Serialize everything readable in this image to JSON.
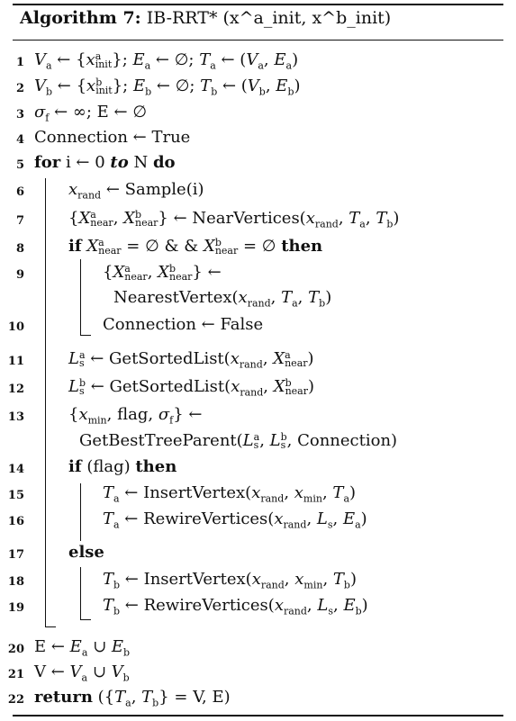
{
  "algorithm": {
    "title_label": "Algorithm 7:",
    "title_text": "IB-RRT* (x^a_init, x^b_init)",
    "lines": [
      {
        "num": "1",
        "text": "V_a ← {x^a_init}; E_a ← ∅; T_a ← (V_a, E_a)"
      },
      {
        "num": "2",
        "text": "V_b ← {x^b_init}; E_b ← ∅; T_b ← (V_b, E_b)"
      },
      {
        "num": "3",
        "text": "σ_f ← ∞; E ← ∅"
      },
      {
        "num": "4",
        "text": "Connection ← True"
      },
      {
        "num": "5",
        "text": "for i ← 0 to N do"
      },
      {
        "num": "6",
        "text": "x_rand ← Sample(i)"
      },
      {
        "num": "7",
        "text": "{X^a_near, X^b_near} ← NearVertices(x_rand, T_a, T_b)"
      },
      {
        "num": "8",
        "text": "if X^a_near = ∅ & & X^b_near = ∅ then"
      },
      {
        "num": "9",
        "text": "{X^a_near, X^b_near} ← NearestVertex(x_rand, T_a, T_b)"
      },
      {
        "num": "10",
        "text": "Connection ← False"
      },
      {
        "num": "11",
        "text": "L^a_s ← GetSortedList(x_rand, X^a_near)"
      },
      {
        "num": "12",
        "text": "L^b_s ← GetSortedList(x_rand, X^b_near)"
      },
      {
        "num": "13",
        "text": "{x_min, flag, σ_f} ← GetBestTreeParent(L^a_s, L^b_s, Connection)"
      },
      {
        "num": "14",
        "text": "if (flag) then"
      },
      {
        "num": "15",
        "text": "T_a ← InsertVertex(x_rand, x_min, T_a)"
      },
      {
        "num": "16",
        "text": "T_a ← RewireVertices(x_rand, L_s, E_a)"
      },
      {
        "num": "17",
        "text": "else"
      },
      {
        "num": "18",
        "text": "T_b ← InsertVertex(x_rand, x_min, T_b)"
      },
      {
        "num": "19",
        "text": "T_b ← RewireVertices(x_rand, L_s, E_b)"
      },
      {
        "num": "20",
        "text": "E ← E_a ∪ E_b"
      },
      {
        "num": "21",
        "text": "V ← V_a ∪ V_b"
      },
      {
        "num": "22",
        "text": "return ({T_a, T_b} = V, E)"
      }
    ]
  }
}
